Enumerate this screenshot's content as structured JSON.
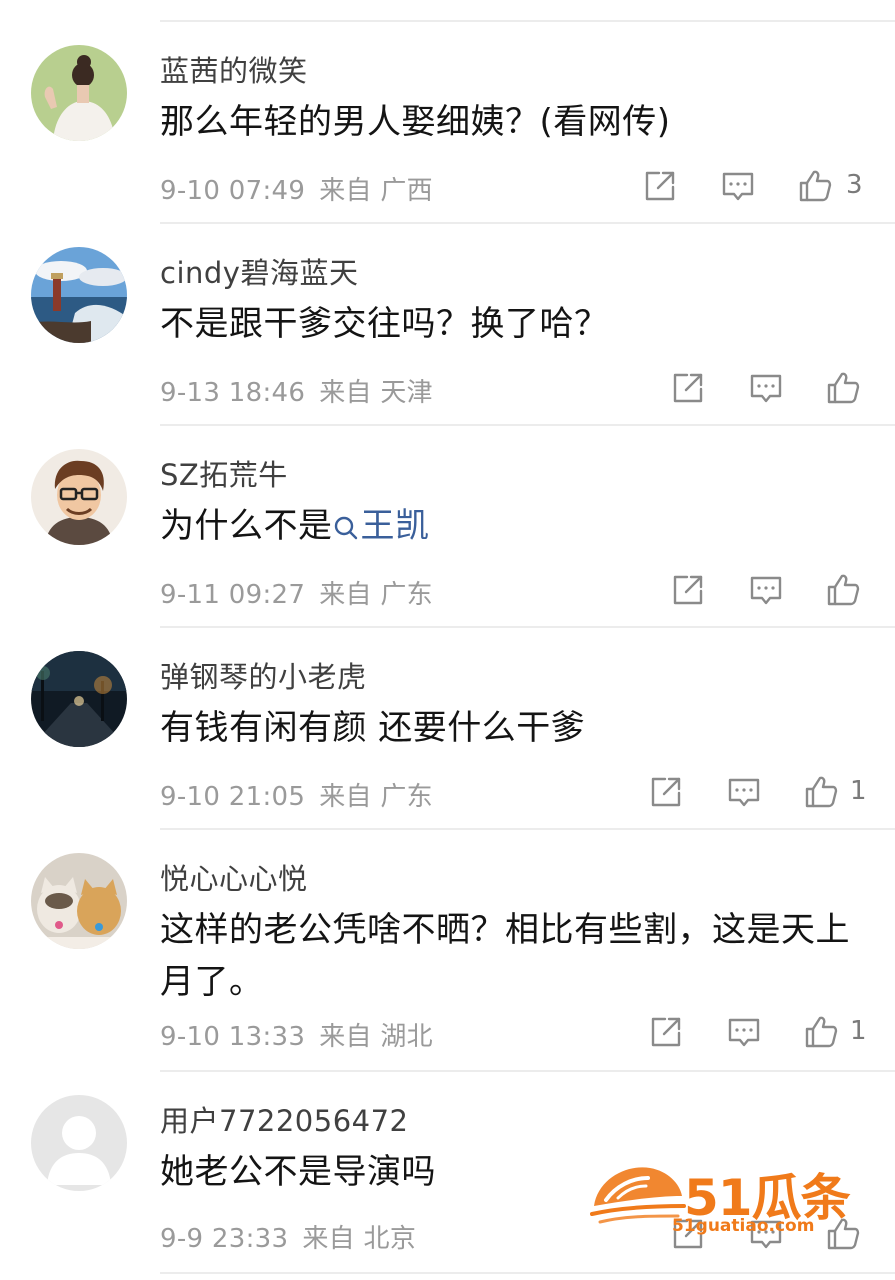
{
  "comments": [
    {
      "username": "蓝茜的微笑",
      "content": "那么年轻的男人娶细姨？(看网传)",
      "time": "9-10 07:49",
      "location": "来自 广西",
      "likes": "3",
      "avatar": "woman-back-avatar"
    },
    {
      "username": "cindy碧海蓝天",
      "content": "不是跟干爹交往吗？换了哈？",
      "time": "9-13 18:46",
      "location": "来自 天津",
      "likes": "",
      "avatar": "lighthouse-avatar"
    },
    {
      "username": "SZ拓荒牛",
      "content_before": "为什么不是",
      "mention": "王凯",
      "time": "9-11 09:27",
      "location": "来自 广东",
      "likes": "",
      "avatar": "cartoon-man-avatar"
    },
    {
      "username": "弹钢琴的小老虎",
      "content": "有钱有闲有颜 还要什么干爹",
      "time": "9-10 21:05",
      "location": "来自 广东",
      "likes": "1",
      "avatar": "night-street-avatar"
    },
    {
      "username": "悦心心心悦",
      "content": "这样的老公凭啥不晒？相比有些割，这是天上月了。",
      "time": "9-10 13:33",
      "location": "来自 湖北",
      "likes": "1",
      "avatar": "cats-avatar"
    },
    {
      "username": "用户7722056472",
      "content": "她老公不是导演吗",
      "time": "9-9 23:33",
      "location": "来自 北京",
      "likes": "",
      "avatar": "default-user-avatar"
    }
  ],
  "watermark": {
    "logo_text": "51瓜条",
    "domain": "51guatiao.com"
  },
  "colors": {
    "mention": "#3a5f9a",
    "meta": "#9a9a9a",
    "watermark": "#f07a1a"
  }
}
